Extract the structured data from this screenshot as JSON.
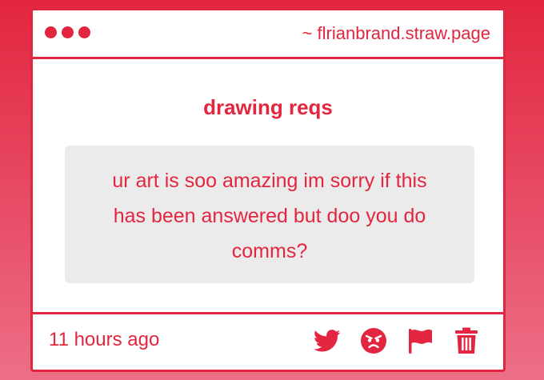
{
  "window": {
    "url": "~ flrianbrand.straw.page"
  },
  "post": {
    "title": "drawing reqs",
    "question": "ur art is soo amazing im sorry if this has been answered but doo you do comms?",
    "timestamp": "11 hours ago"
  },
  "actions": [
    {
      "icon": "twitter-icon"
    },
    {
      "icon": "angry-face-icon"
    },
    {
      "icon": "flag-icon"
    },
    {
      "icon": "trash-icon"
    }
  ],
  "colors": {
    "accent": "#e3263f",
    "card_background": "#ffffff",
    "question_background": "#ecebec"
  }
}
